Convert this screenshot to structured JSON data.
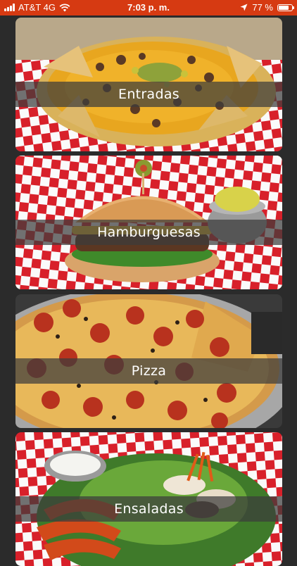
{
  "status_bar": {
    "carrier": "AT&T 4G",
    "time": "7:03 p. m.",
    "battery_percent_label": "77 %",
    "battery_level": 0.77,
    "icons": [
      "signal-bars-icon",
      "wifi-icon",
      "location-arrow-icon",
      "battery-icon"
    ]
  },
  "categories": [
    {
      "label": "Entradas",
      "image": "nachos-photo"
    },
    {
      "label": "Hamburguesas",
      "image": "burger-photo"
    },
    {
      "label": "Pizza",
      "image": "pizza-photo"
    },
    {
      "label": "Ensaladas",
      "image": "salad-photo"
    }
  ],
  "colors": {
    "status_bar": "#d63a12",
    "background": "#2b2b2b",
    "label_band": "#3c3c3c"
  }
}
